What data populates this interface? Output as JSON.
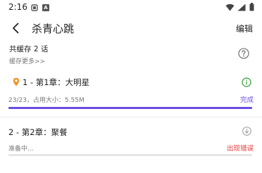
{
  "status_bar": {
    "time": "2:16",
    "a_badge": "A"
  },
  "app_bar": {
    "title": "杀青心跳",
    "edit_label": "编辑"
  },
  "summary": {
    "cached_count_text": "共缓存 2 话",
    "more_link": "缓存更多>>"
  },
  "items": [
    {
      "title": "1 - 第1章：大明星",
      "meta": "23/23，占用大小：5.55M",
      "status": "完成",
      "progress": 1.0,
      "status_color": "#6a4de0",
      "icon": "info-icon"
    },
    {
      "title": "2 - 第2章：聚餐",
      "meta": "准备中...",
      "status": "出现错误",
      "progress": 0.0,
      "status_color": "#e53935",
      "icon": "download-icon"
    }
  ],
  "colors": {
    "accent": "#6a4de0",
    "error": "#e53935"
  }
}
